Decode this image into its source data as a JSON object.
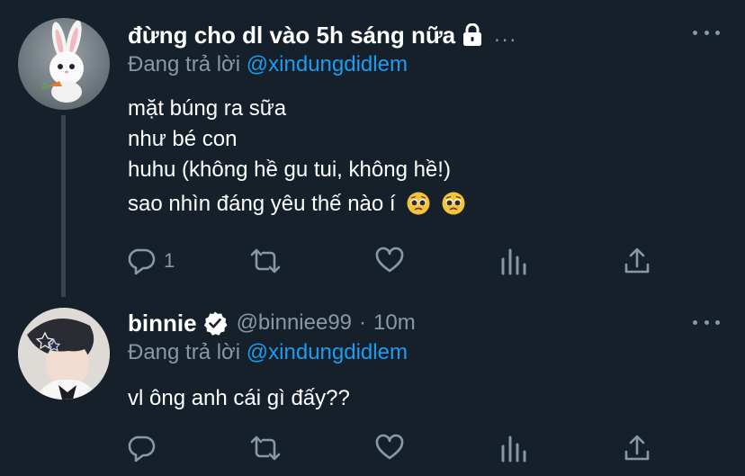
{
  "tweets": [
    {
      "display_name": "đừng cho dl vào 5h sáng nữa",
      "handle": "",
      "time": "",
      "truncation": "...",
      "reply_prefix": "Đang trả lời ",
      "reply_to": "@xindungdidlem",
      "lines": [
        "mặt búng ra sữa",
        "như bé con",
        "huhu (không hề gu tui, không hề!)",
        "sao nhìn đáng yêu thế nào í"
      ],
      "emojis": [
        "pleading-face",
        "pleading-face"
      ],
      "reply_count": "1",
      "avatar": "white-bunny-avatar",
      "protected": true,
      "verified": false
    },
    {
      "display_name": "binnie",
      "handle": "@binniee99",
      "separator": "·",
      "time": "10m",
      "reply_prefix": "Đang trả lời ",
      "reply_to": "@xindungdidlem",
      "lines": [
        "vl ông anh cái gì đấy??"
      ],
      "reply_count": "",
      "avatar": "person-avatar",
      "protected": false,
      "verified": true
    }
  ],
  "colors": {
    "background": "#15202b",
    "text_primary": "#ffffff",
    "text_secondary": "#8899a6",
    "link": "#1d9bf0",
    "thread_line": "#38444d"
  },
  "icons": [
    "reply-icon",
    "retweet-icon",
    "like-icon",
    "analytics-icon",
    "share-icon",
    "more-icon",
    "lock-icon",
    "verified-icon"
  ]
}
